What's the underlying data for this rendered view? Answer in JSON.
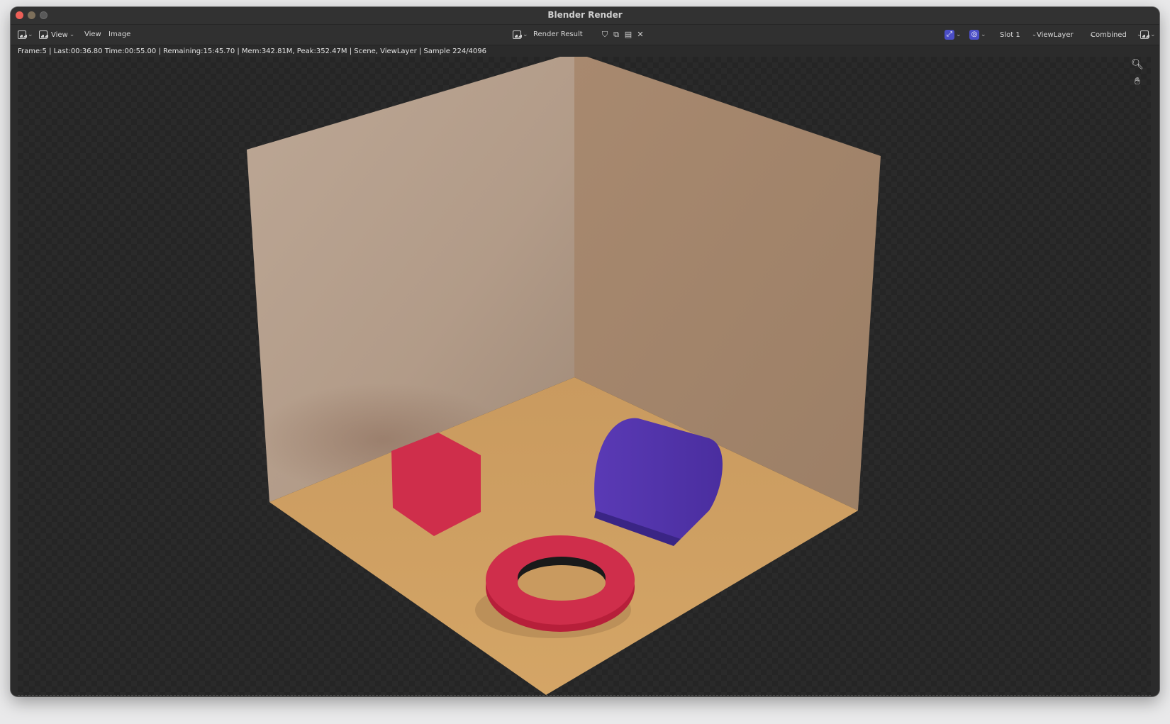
{
  "window": {
    "title": "Blender Render"
  },
  "header": {
    "view_menu_1": "View",
    "view_menu_2": "View",
    "image_menu": "Image",
    "image_name": "Render Result",
    "slot": "Slot 1",
    "view_layer": "ViewLayer",
    "pass": "Combined"
  },
  "status_line": "Frame:5 | Last:00:36.80 Time:00:55.00 | Remaining:15:45.70 | Mem:342.81M, Peak:352.47M | Scene, ViewLayer | Sample 224/4096",
  "icons": {
    "editor_type": "image-editor-icon",
    "zoom": "magnifier-zoom-icon",
    "pan": "hand-pan-icon",
    "gizmo": "gizmo-icon",
    "overlay": "overlay-icon",
    "display_channels": "display-channels-icon",
    "new_image": "new-image-icon",
    "open_image": "open-image-icon",
    "unlink": "close-icon",
    "fake_user": "shield-icon"
  },
  "colors": {
    "accent": "#4b4ec6",
    "floor": "#c4975f",
    "back_wall_left": "#b9a08e",
    "back_wall_right": "#a4856c",
    "red_object": "#cf2e4b",
    "blue_object": "#4f32a8"
  }
}
